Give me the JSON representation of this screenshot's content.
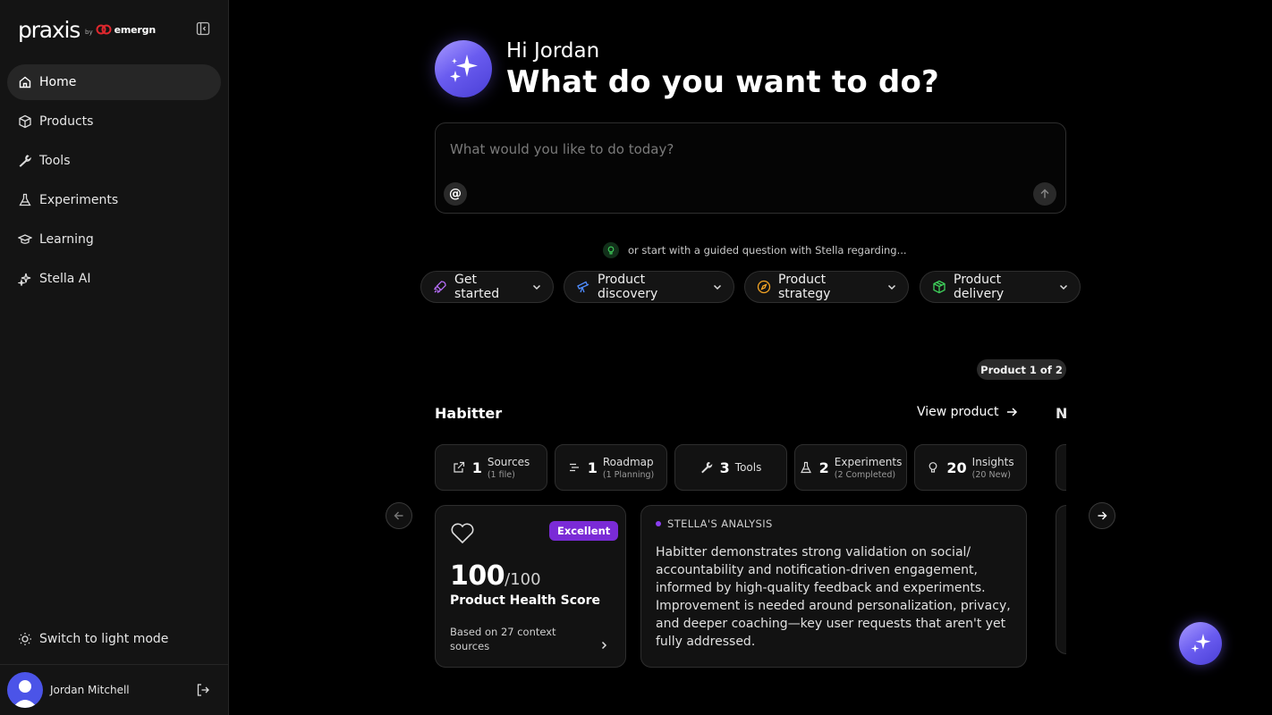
{
  "brand": {
    "name": "praxis",
    "by": "by",
    "partner": "emergn"
  },
  "sidebar": {
    "items": [
      {
        "label": "Home",
        "icon": "home-icon",
        "active": true
      },
      {
        "label": "Products",
        "icon": "box-icon"
      },
      {
        "label": "Tools",
        "icon": "wrench-icon"
      },
      {
        "label": "Experiments",
        "icon": "flask-icon"
      },
      {
        "label": "Learning",
        "icon": "graduation-cap-icon"
      },
      {
        "label": "Stella AI",
        "icon": "sparkles-icon"
      }
    ],
    "theme_toggle": "Switch to light mode",
    "user": {
      "name": "Jordan Mitchell"
    }
  },
  "hero": {
    "greeting": "Hi Jordan",
    "headline": "What do you want to do?"
  },
  "prompt": {
    "placeholder": "What would you like to do today?",
    "value": "",
    "mention_symbol": "@"
  },
  "guided": {
    "text": "or start with a guided question with Stella regarding..."
  },
  "chips": [
    {
      "label": "Get started",
      "icon": "rocket-icon",
      "color": "#b46cf5"
    },
    {
      "label": "Product discovery",
      "icon": "telescope-icon",
      "color": "#4f8cff"
    },
    {
      "label": "Product strategy",
      "icon": "compass-icon",
      "color": "#f5a524"
    },
    {
      "label": "Product delivery",
      "icon": "package-icon",
      "color": "#3ecf5a"
    }
  ],
  "product": {
    "counter": "Product 1 of 2",
    "name": "Habitter",
    "view_label": "View product",
    "next_peek": "N",
    "stats": [
      {
        "num": "1",
        "label": "Sources",
        "sub": "(1 file)",
        "icon": "external-link-icon"
      },
      {
        "num": "1",
        "label": "Roadmap",
        "sub": "(1 Planning)",
        "icon": "roadmap-icon"
      },
      {
        "num": "3",
        "label": "Tools",
        "sub": "",
        "icon": "wrench-icon"
      },
      {
        "num": "2",
        "label": "Experiments",
        "sub": "(2 Completed)",
        "icon": "flask-icon"
      },
      {
        "num": "20",
        "label": "Insights",
        "sub": "(20 New)",
        "icon": "lightbulb-icon"
      }
    ],
    "health": {
      "badge": "Excellent",
      "score": "100",
      "score_max": "/100",
      "title": "Product Health Score",
      "note": "Based on 27 context sources"
    },
    "analysis": {
      "heading": "STELLA'S ANALYSIS",
      "body": "Habitter demonstrates strong validation on social/ accountability and notification-driven engagement, informed by high-quality feedback and experiments. Improvement is needed around personalization, privacy, and deeper coaching—key user requests that aren't yet fully addressed."
    }
  },
  "colors": {
    "accent": "#6a5cf0",
    "badge_purple": "#7a2bd6",
    "bg": "#000000",
    "sidebar_bg": "#141414"
  }
}
